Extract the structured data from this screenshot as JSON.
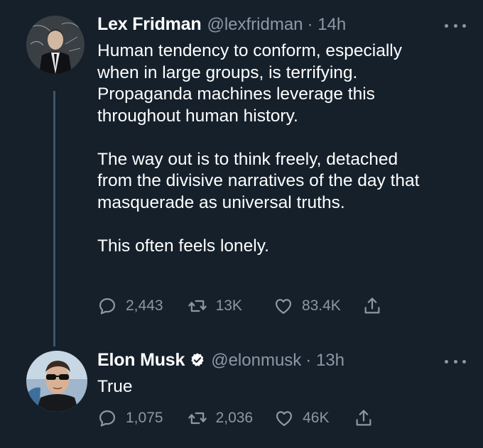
{
  "tweets": [
    {
      "name": "Lex Fridman",
      "handle": "@lexfridman",
      "time": "· 14h",
      "text": "Human tendency to conform, especially\nwhen in large groups, is terrifying.\nPropaganda machines leverage this\nthroughout human history.\n\nThe way out is to think freely, detached\nfrom the divisive narratives of the day that\nmasquerade as universal truths.\n\nThis often feels lonely.",
      "replies": "2,443",
      "retweets": "13K",
      "likes": "83.4K"
    },
    {
      "name": "Elon Musk",
      "handle": "@elonmusk",
      "time": "· 13h",
      "text": "True",
      "replies": "1,075",
      "retweets": "2,036",
      "likes": "46K"
    }
  ],
  "colors": {
    "background": "#15202b",
    "muted": "#8b98a5",
    "thread_line": "#3d5466",
    "verified": "#ffffff"
  },
  "icons": [
    "reply-icon",
    "retweet-icon",
    "like-icon",
    "share-icon",
    "verified-icon",
    "more-icon"
  ]
}
